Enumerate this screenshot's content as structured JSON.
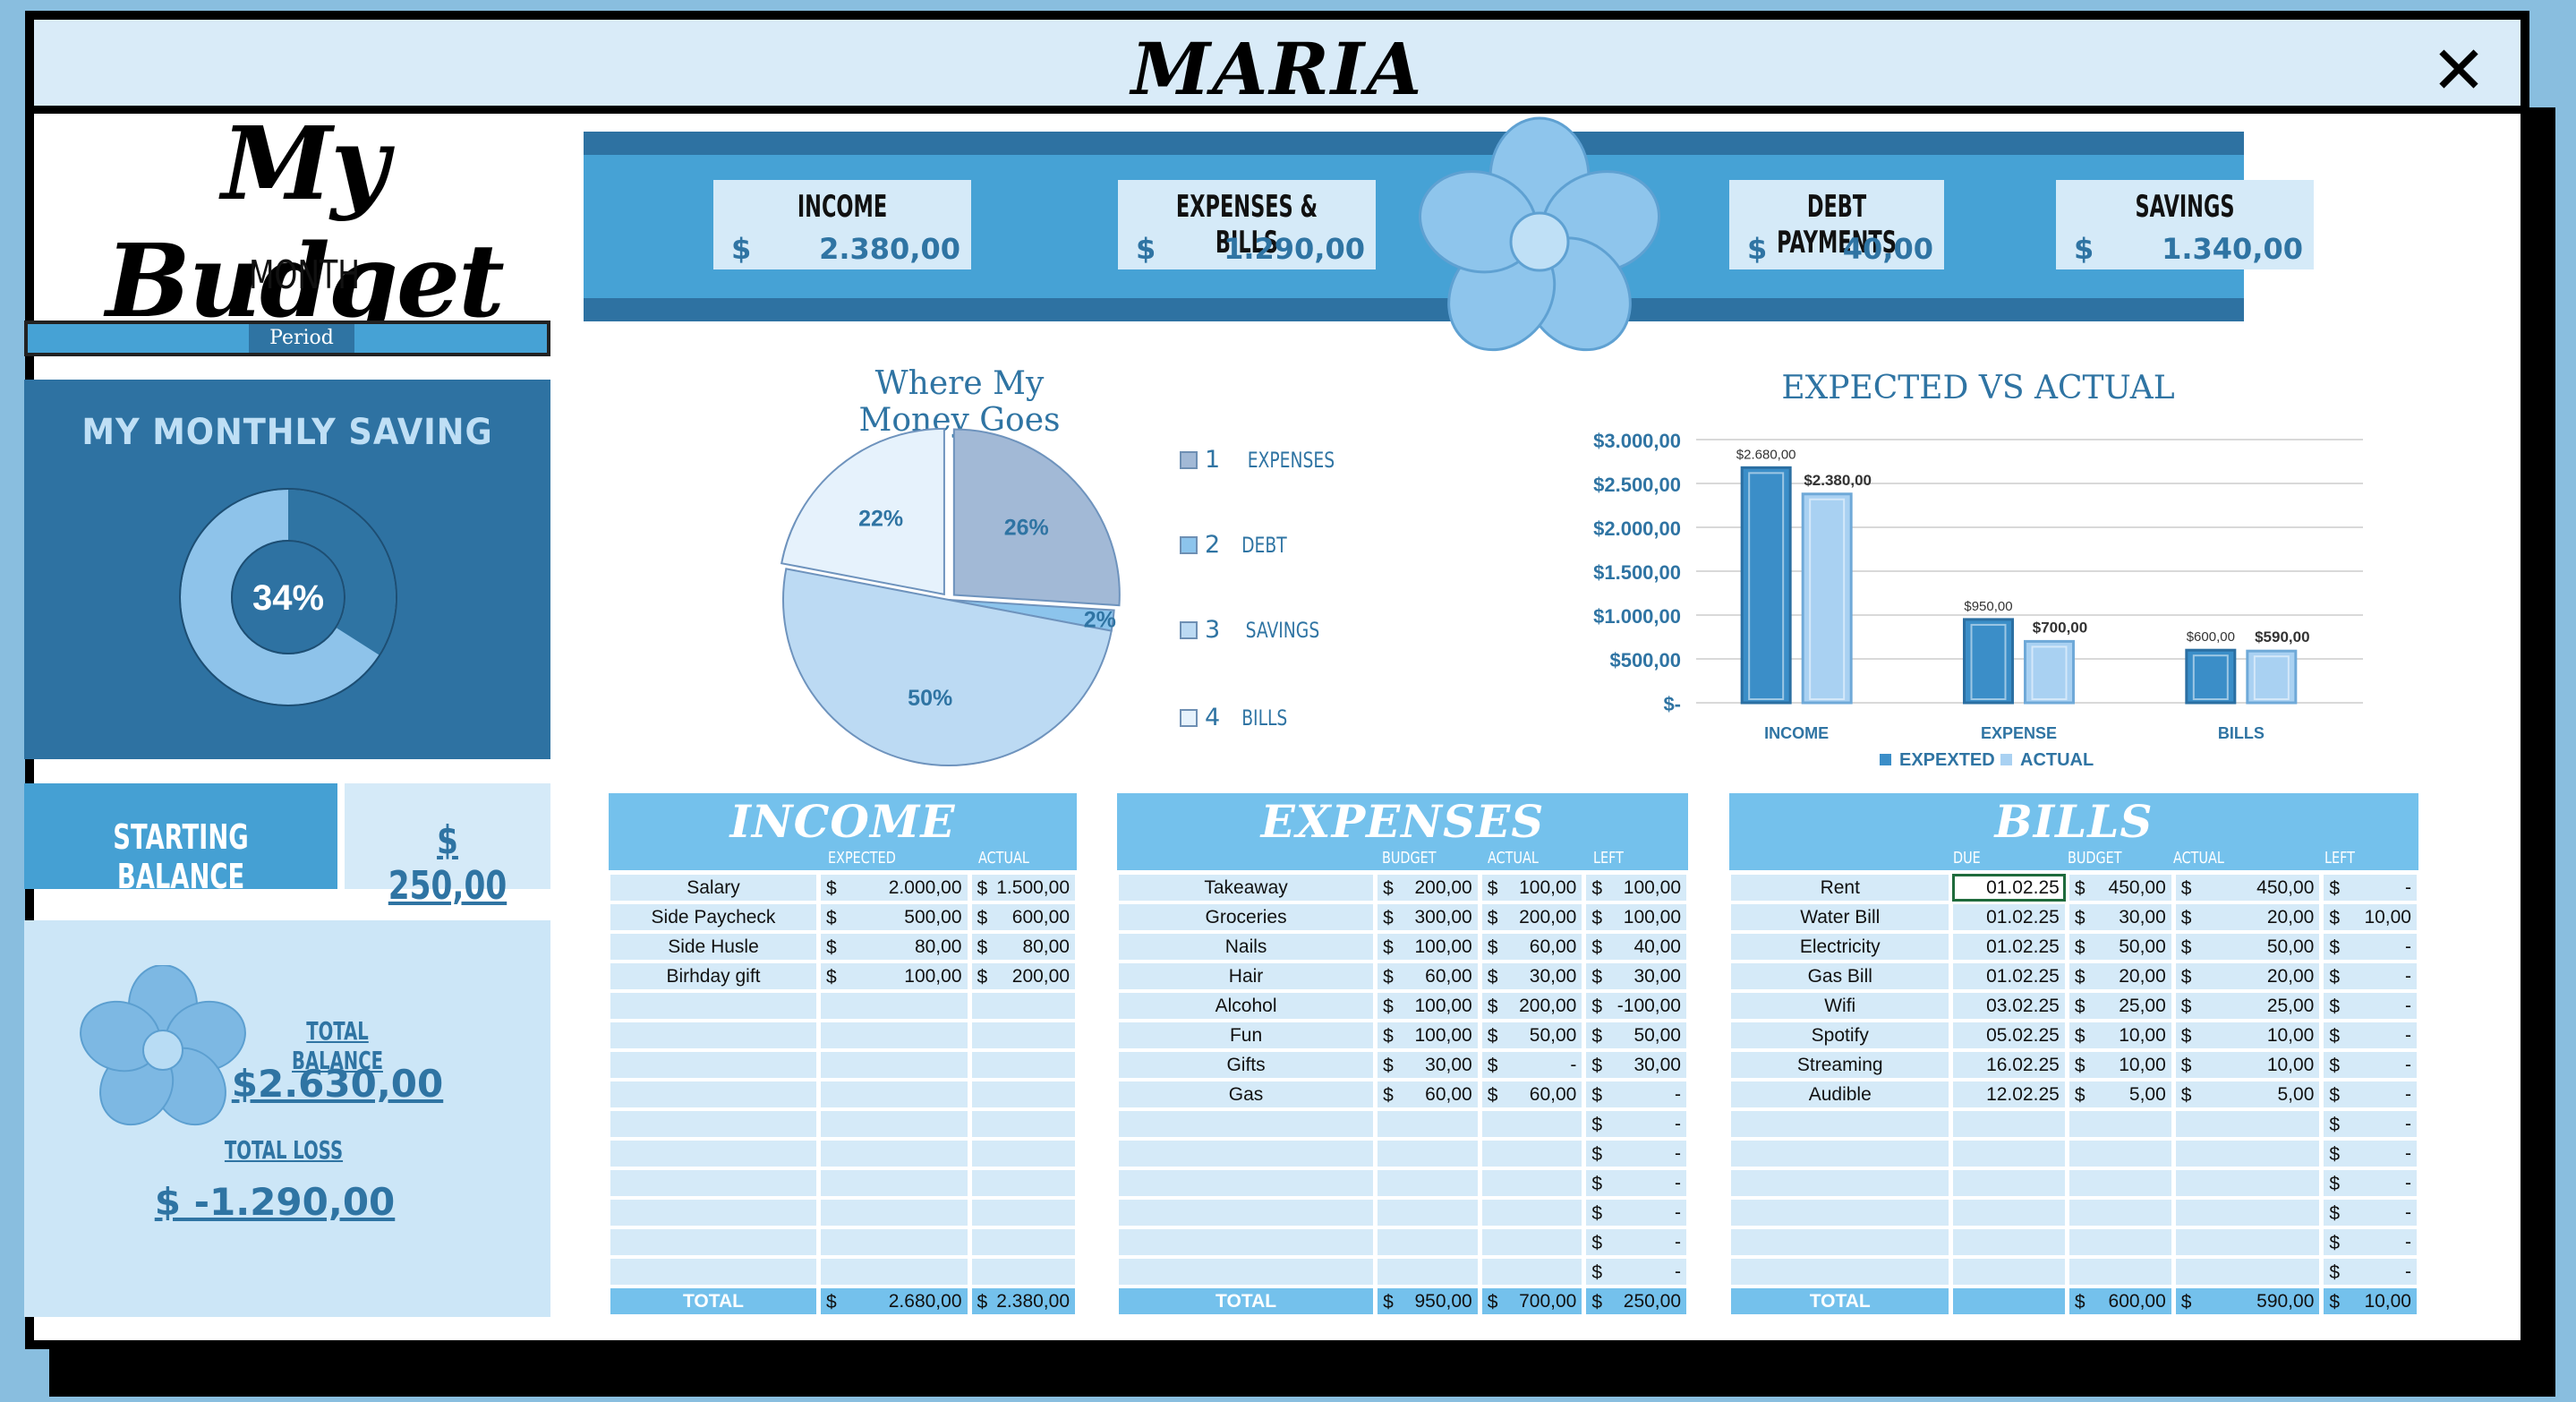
{
  "window": {
    "title": "MARIA",
    "close_symbol": "✕"
  },
  "sidebar": {
    "budget_title": "My Budget",
    "month_label": "MONTH",
    "period_label": "Period",
    "saving_title": "MY MONTHLY SAVING",
    "saving_percent": "34%",
    "saving_fraction": 0.34,
    "starting_balance_label": "STARTING BALANCE",
    "starting_balance_value": "$    250,00",
    "total_balance_label": "TOTAL BALANCE",
    "total_balance_value": "$2.630,00",
    "total_loss_label": "TOTAL LOSS",
    "total_loss_value": "$ -1.290,00"
  },
  "kpis": [
    {
      "label": "INCOME",
      "currency": "$",
      "value": "2.380,00"
    },
    {
      "label": "EXPENSES & BILLS",
      "currency": "$",
      "value": "1.290,00"
    },
    {
      "label": "DEBT PAYMENTS",
      "currency": "$",
      "value": "40,00"
    },
    {
      "label": "SAVINGS",
      "currency": "$",
      "value": "1.340,00"
    }
  ],
  "colors": {
    "dark_blue": "#2e72a2",
    "mid_blue": "#46a2d5",
    "light_blue": "#74c1ec",
    "pale_blue": "#d5eaf8",
    "text_blue": "#2f74a3"
  },
  "chart_data": [
    {
      "type": "pie",
      "title": "Where My Money Goes",
      "categories": [
        "1",
        "2",
        "3",
        "4"
      ],
      "legend_labels": [
        "EXPENSES",
        "DEBT",
        "SAVINGS",
        "BILLS"
      ],
      "values": [
        26,
        2,
        50,
        22
      ],
      "data_labels": [
        "26%",
        "2%",
        "50%",
        "22%"
      ],
      "colors": [
        "#a2b9d6",
        "#8cc4ec",
        "#bcdaf3",
        "#e6f2fc"
      ]
    },
    {
      "type": "bar",
      "title": "EXPECTED VS ACTUAL",
      "categories": [
        "INCOME",
        "EXPENSE",
        "BILLS"
      ],
      "series": [
        {
          "name": "EXPEXTED",
          "values": [
            2680,
            950,
            600
          ],
          "labels": [
            "$2.680,00",
            "$950,00",
            "$600,00"
          ]
        },
        {
          "name": "ACTUAL",
          "values": [
            2380,
            700,
            590
          ],
          "labels": [
            "$2.380,00",
            "$700,00",
            "$590,00"
          ]
        }
      ],
      "ylim": [
        0,
        3000
      ],
      "yticks": [
        0,
        500,
        1000,
        1500,
        2000,
        2500,
        3000
      ],
      "ytick_labels": [
        "$-",
        "$500,00",
        "$1.000,00",
        "$1.500,00",
        "$2.000,00",
        "$2.500,00",
        "$3.000,00"
      ],
      "legend": "bottom",
      "grid": true
    }
  ],
  "income": {
    "title": "INCOME",
    "columns": [
      "EXPECTED",
      "ACTUAL"
    ],
    "rows": [
      [
        "Salary",
        "2.000,00",
        "1.500,00"
      ],
      [
        "Side Paycheck",
        "500,00",
        "600,00"
      ],
      [
        "Side Husle",
        "80,00",
        "80,00"
      ],
      [
        "Birhday gift",
        "100,00",
        "200,00"
      ],
      [
        "",
        "",
        ""
      ],
      [
        "",
        "",
        ""
      ],
      [
        "",
        "",
        ""
      ],
      [
        "",
        "",
        ""
      ],
      [
        "",
        "",
        ""
      ],
      [
        "",
        "",
        ""
      ],
      [
        "",
        "",
        ""
      ],
      [
        "",
        "",
        ""
      ],
      [
        "",
        "",
        ""
      ],
      [
        "",
        "",
        ""
      ]
    ],
    "total": [
      "TOTAL",
      "2.680,00",
      "2.380,00"
    ]
  },
  "expenses": {
    "title": "EXPENSES",
    "columns": [
      "BUDGET",
      "ACTUAL",
      "LEFT"
    ],
    "rows": [
      [
        "Takeaway",
        "200,00",
        "100,00",
        "100,00"
      ],
      [
        "Groceries",
        "300,00",
        "200,00",
        "100,00"
      ],
      [
        "Nails",
        "100,00",
        "60,00",
        "40,00"
      ],
      [
        "Hair",
        "60,00",
        "30,00",
        "30,00"
      ],
      [
        "Alcohol",
        "100,00",
        "200,00",
        "-100,00"
      ],
      [
        "Fun",
        "100,00",
        "50,00",
        "50,00"
      ],
      [
        "Gifts",
        "30,00",
        "-",
        "30,00"
      ],
      [
        "Gas",
        "60,00",
        "60,00",
        "-"
      ],
      [
        "",
        "",
        "",
        "-"
      ],
      [
        "",
        "",
        "",
        "-"
      ],
      [
        "",
        "",
        "",
        "-"
      ],
      [
        "",
        "",
        "",
        "-"
      ],
      [
        "",
        "",
        "",
        "-"
      ],
      [
        "",
        "",
        "",
        "-"
      ]
    ],
    "total": [
      "TOTAL",
      "950,00",
      "700,00",
      "250,00"
    ]
  },
  "bills": {
    "title": "BILLS",
    "columns": [
      "DUE",
      "BUDGET",
      "ACTUAL",
      "LEFT"
    ],
    "rows": [
      [
        "Rent",
        "01.02.25",
        "450,00",
        "450,00",
        "-"
      ],
      [
        "Water Bill",
        "01.02.25",
        "30,00",
        "20,00",
        "10,00"
      ],
      [
        "Electricity",
        "01.02.25",
        "50,00",
        "50,00",
        "-"
      ],
      [
        "Gas Bill",
        "01.02.25",
        "20,00",
        "20,00",
        "-"
      ],
      [
        "Wifi",
        "03.02.25",
        "25,00",
        "25,00",
        "-"
      ],
      [
        "Spotify",
        "05.02.25",
        "10,00",
        "10,00",
        "-"
      ],
      [
        "Streaming",
        "16.02.25",
        "10,00",
        "10,00",
        "-"
      ],
      [
        "Audible",
        "12.02.25",
        "5,00",
        "5,00",
        "-"
      ],
      [
        "",
        "",
        "",
        "",
        "-"
      ],
      [
        "",
        "",
        "",
        "",
        "-"
      ],
      [
        "",
        "",
        "",
        "",
        "-"
      ],
      [
        "",
        "",
        "",
        "",
        "-"
      ],
      [
        "",
        "",
        "",
        "",
        "-"
      ],
      [
        "",
        "",
        "",
        "",
        "-"
      ]
    ],
    "total": [
      "TOTAL",
      "",
      "600,00",
      "590,00",
      "10,00"
    ]
  }
}
